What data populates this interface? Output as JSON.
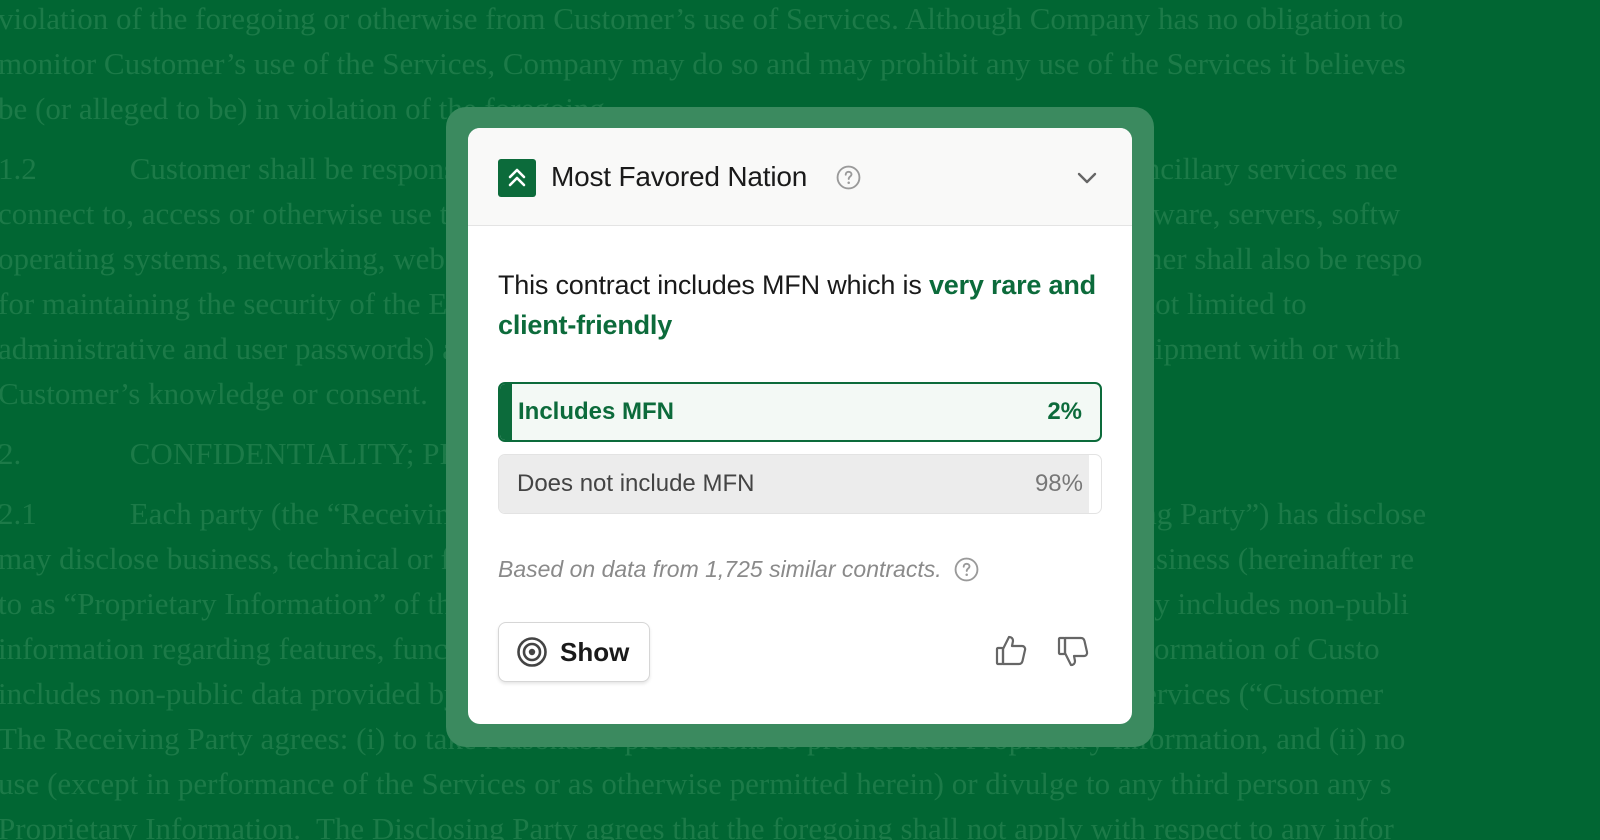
{
  "background_document": {
    "lines": [
      "violation of the foregoing or otherwise from Customer’s use of Services. Although Company has no obligation to",
      "monitor Customer’s use of the Services, Company may do so and may prohibit any use of the Services it believes",
      "be (or alleged to be) in violation of the foregoing.",
      "1.2            Customer shall be responsible for obtaining and maintaining any equipment and ancillary services nee",
      "connect to, access or otherwise use the Services, including, without limitation, modems, hardware, servers, softw",
      "operating systems, networking, web servers and the like (collectively, “Equipment”).  Customer shall also be respo",
      "for maintaining the security of the Equipment, Customer account, passwords (including but not limited to",
      "administrative and user passwords) and files, and for all uses of Customer account or the Equipment with or with",
      "Customer’s knowledge or consent.",
      "2.              CONFIDENTIALITY; PROPRIETARY RIGHTS",
      "2.1            Each party (the “Receiving Party”) understands that the other party (the “Disclosing Party”) has disclose",
      "may disclose business, technical or financial information relating to the Disclosing Party’s business (hereinafter re",
      "to as “Proprietary Information” of the Disclosing Party).  Proprietary Information of Company includes non-publi",
      "information regarding features, functionality and performance of the Service.  Proprietary Information of Custo",
      "includes non-public data provided by Customer to Company to enable the provision of the Services (“Customer",
      "The Receiving Party agrees: (i) to take reasonable precautions to protect such Proprietary Information, and (ii) no",
      "use (except in performance of the Services or as otherwise permitted herein) or divulge to any third person any s",
      "Proprietary Information.  The Disclosing Party agrees that the foregoing shall not apply with respect to any infor"
    ]
  },
  "card": {
    "title": "Most Favored Nation",
    "logo_icon": "double-chevron-up-icon",
    "headline_prefix": "This contract includes MFN which is ",
    "headline_highlight": "very rare and client-friendly",
    "options": [
      {
        "label": "Includes MFN",
        "percent_text": "2%",
        "share": 0.02,
        "selected": true
      },
      {
        "label": "Does not include MFN",
        "percent_text": "98%",
        "share": 0.98,
        "selected": false
      }
    ],
    "footnote": "Based on data from 1,725 similar contracts.",
    "show_button_label": "Show",
    "show_button_icon": "target-icon"
  },
  "colors": {
    "page_background": "#016633",
    "halo": "#3b8a5f",
    "accent": "#0c6b3b",
    "muted_text": "#8a8a8a"
  }
}
